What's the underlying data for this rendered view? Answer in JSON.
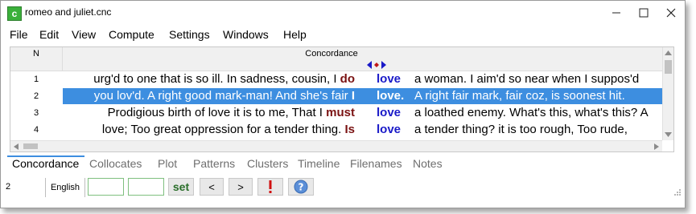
{
  "window": {
    "title": "romeo and juliet.cnc"
  },
  "menu": [
    "File",
    "Edit",
    "View",
    "Compute",
    "Settings",
    "Windows",
    "Help"
  ],
  "grid": {
    "col_n": "N",
    "col_concordance": "Concordance",
    "rows": [
      {
        "n": "1",
        "left": "urg'd to one that is so ill. In sadness, cousin, I",
        "collocate": "do",
        "node": "love",
        "right": "a woman. I aim'd so near when I suppos'd"
      },
      {
        "n": "2",
        "left": "you lov'd. A right good mark-man! And she's fair",
        "collocate": "I",
        "node": "love.",
        "right": "A right fair mark, fair coz, is soonest hit."
      },
      {
        "n": "3",
        "left": "Prodigious birth of love it is to me, That I",
        "collocate": "must",
        "node": "love",
        "right": "a loathed enemy. What's this, what's this? A"
      },
      {
        "n": "4",
        "left": "love; Too great oppression for a tender thing.",
        "collocate": "Is",
        "node": "love",
        "right": "a tender thing? it is too rough, Too rude,"
      }
    ]
  },
  "tabs": [
    "Concordance",
    "Collocates",
    "Plot",
    "Patterns",
    "Clusters",
    "Timeline",
    "Filenames",
    "Notes"
  ],
  "status": {
    "count": "2",
    "language": "English",
    "set_label": "set",
    "prev_label": "<",
    "next_label": ">"
  },
  "colors": {
    "selection": "#3d8ee0",
    "node": "#1a1ac8",
    "collocate": "#7a1212",
    "accent": "#3bb03b"
  }
}
